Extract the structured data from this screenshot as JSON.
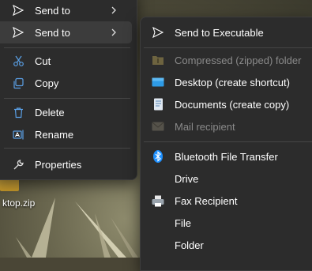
{
  "desktop": {
    "file_label": "ktop.zip"
  },
  "context_menu": {
    "items": [
      {
        "label": "Send to"
      },
      {
        "label": "Send to"
      },
      {
        "label": "Cut"
      },
      {
        "label": "Copy"
      },
      {
        "label": "Delete"
      },
      {
        "label": "Rename"
      },
      {
        "label": "Properties"
      }
    ]
  },
  "send_to_menu": {
    "items": [
      {
        "label": "Send to Executable",
        "icon": "send-icon"
      },
      {
        "label": "Compressed (zipped) folder",
        "icon": "zip-folder-icon",
        "disabled": true
      },
      {
        "label": "Desktop (create shortcut)",
        "icon": "desktop-icon"
      },
      {
        "label": "Documents (create copy)",
        "icon": "documents-icon"
      },
      {
        "label": "Mail recipient",
        "icon": "mail-icon",
        "disabled": true
      },
      {
        "label": "Bluetooth File Transfer",
        "icon": "bluetooth-icon"
      },
      {
        "label": "Drive"
      },
      {
        "label": "Fax Recipient",
        "icon": "fax-icon"
      },
      {
        "label": "File"
      },
      {
        "label": "Folder"
      }
    ]
  },
  "colors": {
    "menu_bg": "#2c2c2c",
    "hover_bg": "#3c3c3c",
    "text": "#ffffff",
    "disabled_text": "#8a8a8a",
    "bluetooth_blue": "#1e90ff"
  }
}
